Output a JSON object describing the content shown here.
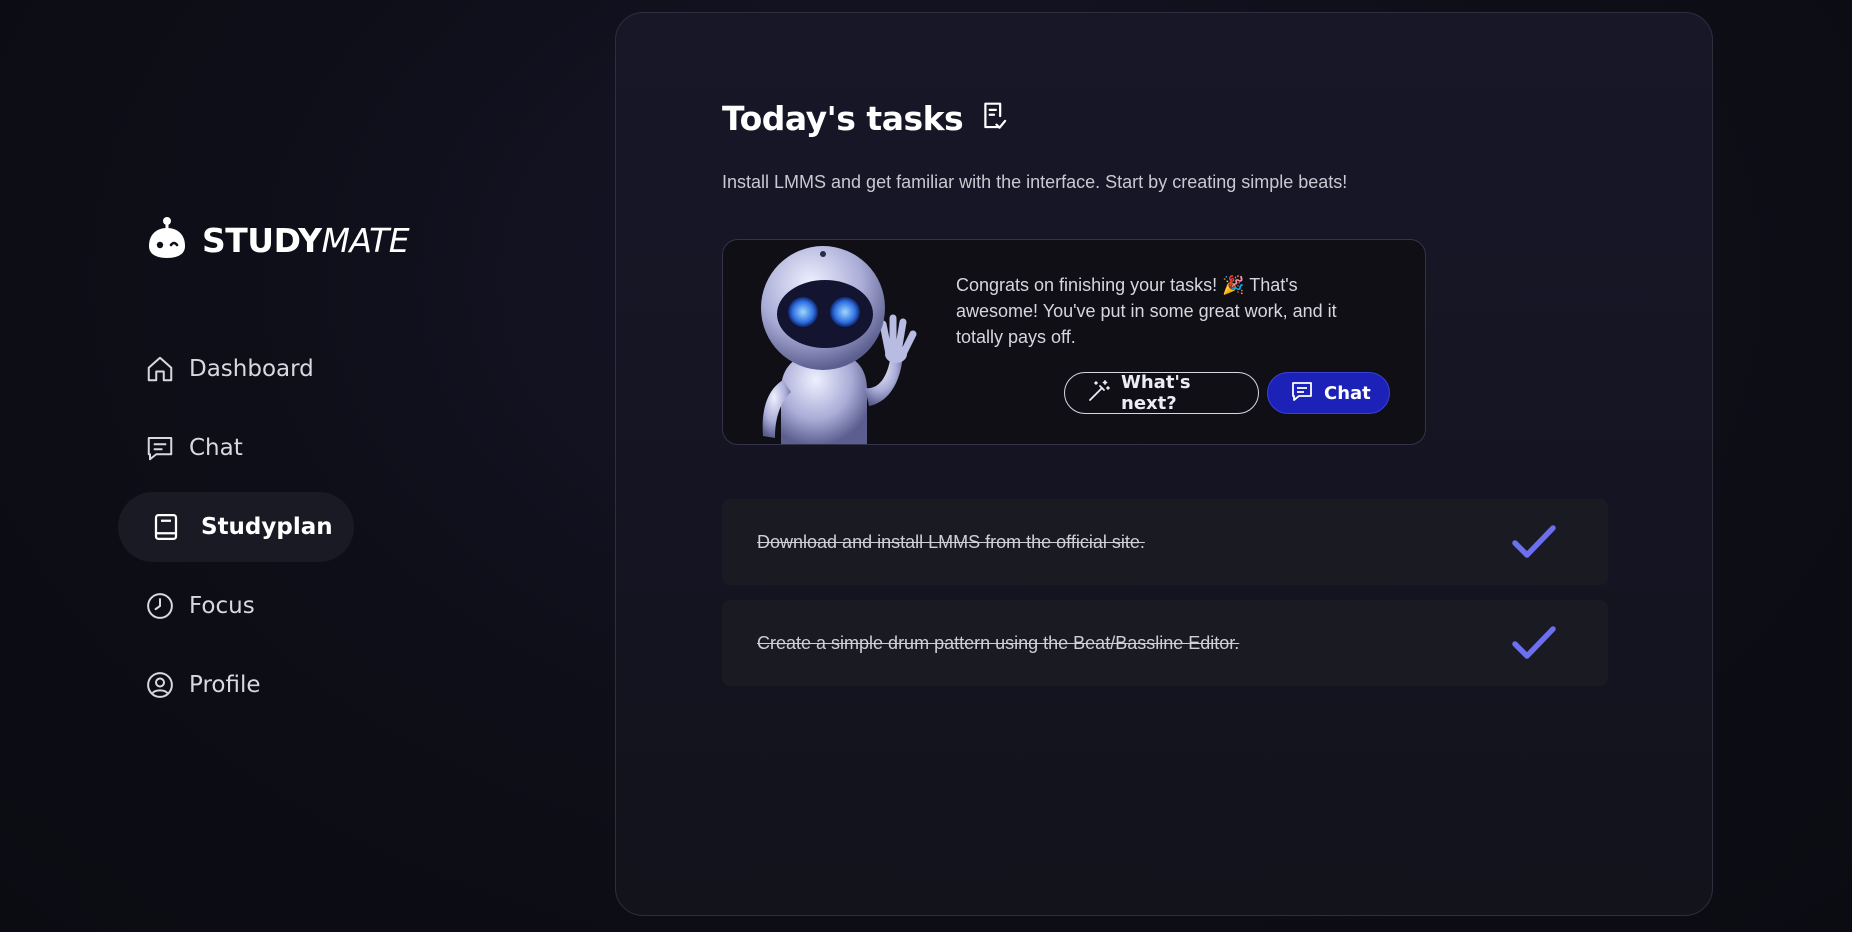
{
  "sidebar": {
    "logo": {
      "bold": "STUDY",
      "italic": "MATE",
      "icon": "robot-head-icon"
    },
    "items": [
      {
        "label": "Dashboard",
        "icon": "home-icon",
        "active": false
      },
      {
        "label": "Chat",
        "icon": "chat-bubble-icon",
        "active": false
      },
      {
        "label": "Studyplan",
        "icon": "book-icon",
        "active": true
      },
      {
        "label": "Focus",
        "icon": "clock-icon",
        "active": false
      },
      {
        "label": "Profile",
        "icon": "user-circle-icon",
        "active": false
      }
    ]
  },
  "main": {
    "title": "Today's tasks",
    "title_icon": "clipboard-check-icon",
    "subtitle": "Install LMMS and get familiar with the interface. Start by creating simple beats!",
    "congrats": {
      "message": "Congrats on finishing your tasks! 🎉 That's awesome! You've put in some great work, and it totally pays off.",
      "whats_next_label": "What's next?",
      "whats_next_icon": "magic-wand-icon",
      "chat_label": "Chat",
      "chat_icon": "chat-bubble-icon"
    },
    "tasks": [
      {
        "text": "Download and install LMMS from the official site.",
        "done": true
      },
      {
        "text": "Create a simple drum pattern using the Beat/Bassline Editor.",
        "done": true
      }
    ]
  },
  "colors": {
    "accent": "#1c22b8",
    "check": "#6b6ff0",
    "panel_border": "#2e2e3d"
  }
}
